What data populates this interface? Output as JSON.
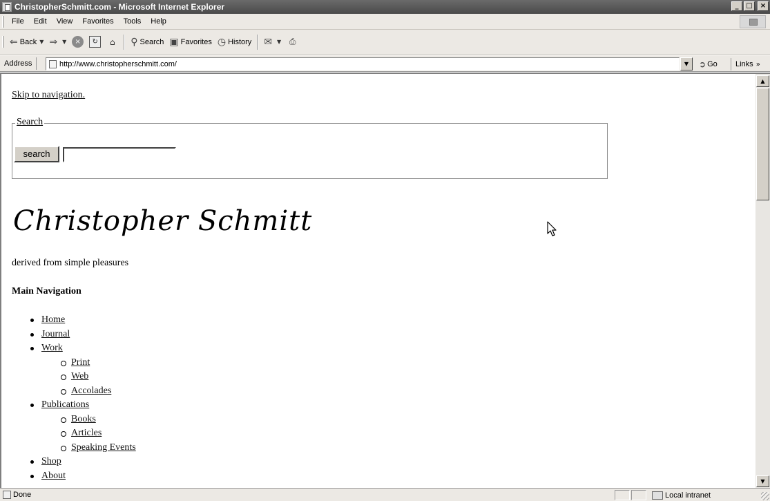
{
  "window": {
    "title": "ChristopherSchmitt.com - Microsoft Internet Explorer",
    "controls": [
      "_",
      "□",
      "×"
    ]
  },
  "menu": [
    "File",
    "Edit",
    "View",
    "Favorites",
    "Tools",
    "Help"
  ],
  "toolbar": {
    "back_label": "Back",
    "search_label": "Search",
    "favorites_label": "Favorites",
    "history_label": "History"
  },
  "address": {
    "label": "Address",
    "url": "http://www.christopherschmitt.com/",
    "go_label": "Go",
    "links_label": "Links"
  },
  "page": {
    "skip_link": "Skip to navigation.",
    "search_legend": "Search",
    "search_button": "search",
    "search_value": "",
    "logo_text": "Christopher Schmitt",
    "tagline": "derived from simple pleasures",
    "nav_heading": "Main Navigation",
    "nav": [
      {
        "label": "Home",
        "level": 1
      },
      {
        "label": "Journal",
        "level": 1
      },
      {
        "label": "Work",
        "level": 1
      },
      {
        "label": "Print",
        "level": 2
      },
      {
        "label": "Web",
        "level": 2
      },
      {
        "label": "Accolades",
        "level": 2
      },
      {
        "label": "Publications",
        "level": 1
      },
      {
        "label": "Books",
        "level": 2
      },
      {
        "label": "Articles",
        "level": 2
      },
      {
        "label": "Speaking Events",
        "level": 2
      },
      {
        "label": "Shop",
        "level": 1
      },
      {
        "label": "About",
        "level": 1
      }
    ]
  },
  "status": {
    "text": "Done",
    "zone": "Local intranet"
  },
  "scroll": {
    "position_fraction": 0.0
  }
}
